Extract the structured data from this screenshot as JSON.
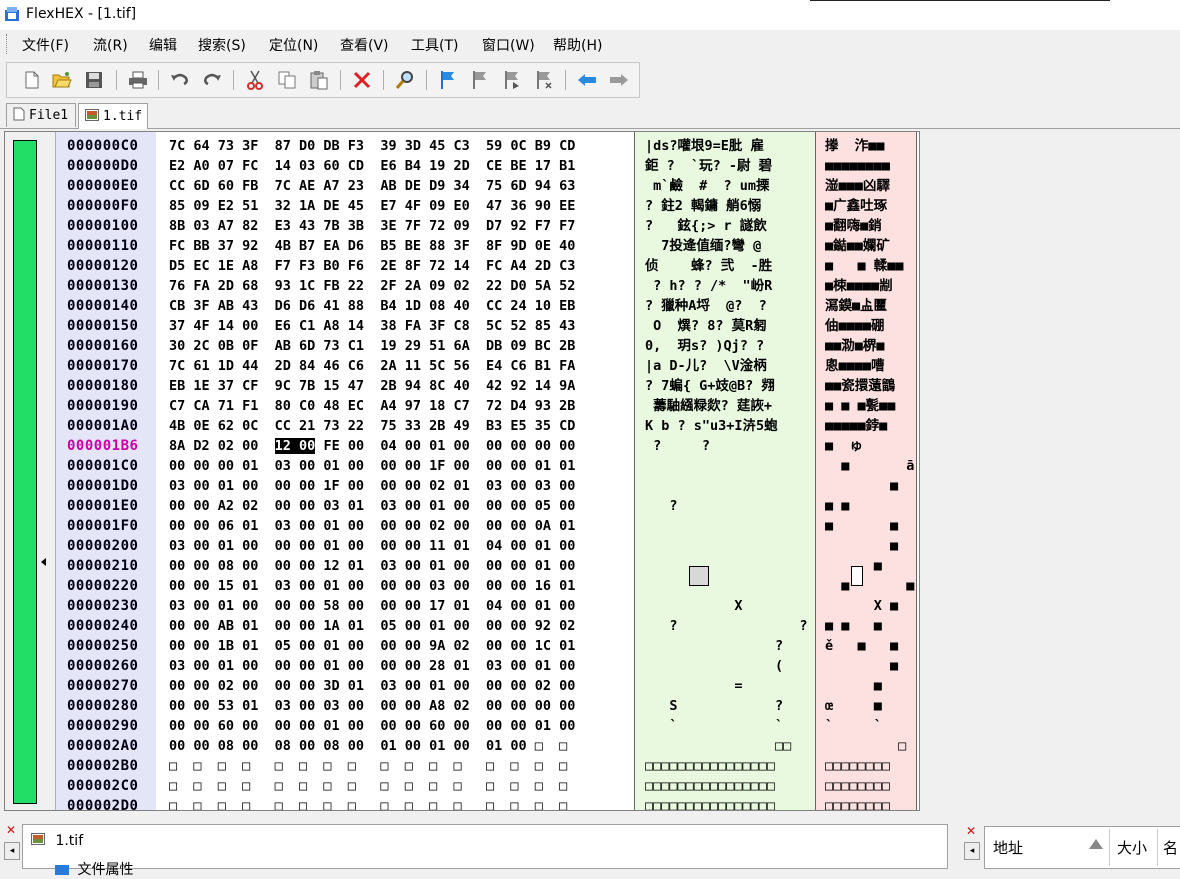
{
  "window": {
    "title": "FlexHEX - [1.tif]"
  },
  "menu": [
    "文件(F)",
    "流(R)",
    "编辑",
    "搜索(S)",
    "定位(N)",
    "查看(V)",
    "工具(T)",
    "窗口(W)",
    "帮助(H)"
  ],
  "toolbar": {
    "buttons": [
      {
        "name": "new-file-icon",
        "glyph": "🗋"
      },
      {
        "name": "open-folder-icon",
        "glyph": "📂"
      },
      {
        "name": "save-icon",
        "glyph": "💾"
      },
      {
        "name": "print-icon",
        "glyph": "🖶"
      },
      {
        "name": "undo-icon",
        "glyph": "↶"
      },
      {
        "name": "redo-icon",
        "glyph": "↷"
      },
      {
        "name": "cut-icon",
        "glyph": "✂"
      },
      {
        "name": "copy-icon",
        "glyph": "⎘"
      },
      {
        "name": "paste-icon",
        "glyph": "📋"
      },
      {
        "name": "delete-icon",
        "glyph": "✕"
      },
      {
        "name": "find-icon",
        "glyph": "🔎"
      },
      {
        "name": "bookmark-flag-icon",
        "glyph": "⚑"
      },
      {
        "name": "bookmark-prev-icon",
        "glyph": "⚑"
      },
      {
        "name": "bookmark-next-icon",
        "glyph": "⚑"
      },
      {
        "name": "bookmark-clear-icon",
        "glyph": "⚑"
      },
      {
        "name": "back-arrow-icon",
        "glyph": "⇦"
      },
      {
        "name": "forward-arrow-icon",
        "glyph": "⇨"
      }
    ]
  },
  "tabs": [
    {
      "label": "File1",
      "icon": "document-icon",
      "active": false
    },
    {
      "label": "1.tif",
      "icon": "image-file-icon",
      "active": true
    }
  ],
  "editor": {
    "rows": [
      {
        "addr": "000000C0",
        "hex": "7C 64 73 3F  87 D0 DB F3  39 3D 45 C3  59 0C B9 CD",
        "ascii": "|ds?嚾垠9=E肶 雇",
        "uni": "搼  泎■■"
      },
      {
        "addr": "000000D0",
        "hex": "E2 A0 07 FC  14 03 60 CD  E6 B4 19 2D  CE BE 17 B1",
        "ascii": "鉅 ?  `玩? -尉 碧",
        "uni": "■■■■■■■■"
      },
      {
        "addr": "000000E0",
        "hex": "CC 6D 60 FB  7C AE A7 23  AB DE D9 34  75 6D 94 63",
        "ascii": " m`鹼  #  ? um搮",
        "uni": "潂■■■凶驛"
      },
      {
        "addr": "000000F0",
        "hex": "85 09 E2 51  32 1A DE 45  E7 4F 09 E0  47 36 90 EE",
        "ascii": "? 鉒2 輵鏞 艄6愵",
        "uni": "■广鑫吐琢"
      },
      {
        "addr": "00000100",
        "hex": "8B 03 A7 82  E3 43 7B 3B  3E 7F 72 09  D7 92 F7 F7",
        "ascii": "?   鉉{;> r 譢飲",
        "uni": "■翻嗨■銷"
      },
      {
        "addr": "00000110",
        "hex": "FC BB 37 92  4B B7 EA D6  B5 BE 88 3F  8F 9D 0E 40",
        "ascii": "  7投逄值缅?彎 @",
        "uni": "■鐑■■孄矿"
      },
      {
        "addr": "00000120",
        "hex": "D5 EC 1E A8  F7 F3 B0 F6  2E 8F 72 14  FC A4 2D C3",
        "ascii": "侦    蜂? 弐  -胜",
        "uni": "■   ■ 輮■■"
      },
      {
        "addr": "00000130",
        "hex": "76 FA 2D 68  93 1C FB 22  2F 2A 09 02  22 D0 5A 52",
        "ascii": " ? h? ? /*  \"岎R",
        "uni": "■梀■■■■剬"
      },
      {
        "addr": "00000140",
        "hex": "CB 3F AB 43  D6 D6 41 88  B4 1D 08 40  CC 24 10 EB",
        "ascii": "? 獵种A埒  @?  ?",
        "uni": "㵼鏌■盀匷"
      },
      {
        "addr": "00000150",
        "hex": "37 4F 14 00  E6 C1 A8 14  38 FA 3F C8  5C 52 85 43",
        "ascii": " O  熼? 8? 莫R匑",
        "uni": "伷■■■■硼"
      },
      {
        "addr": "00000160",
        "hex": "30 2C 0B 0F  AB 6D 73 C1  19 29 51 6A  DB 09 BC 2B",
        "ascii": "0,  玥s? )Qj? ?",
        "uni": "■■泐■楐■"
      },
      {
        "addr": "00000170",
        "hex": "7C 61 1D 44  2D 84 46 C6  2A 11 5C 56  E4 C6 B1 FA",
        "ascii": "|a D-儿?  \\V淦柄",
        "uni": "悤■■■■嘈"
      },
      {
        "addr": "00000180",
        "hex": "EB 1E 37 CF  9C 7B 15 47  2B 94 8C 40  42 92 14 9A",
        "ascii": "? 7蝙{ G+攱@B? 翙",
        "uni": "■■瓷擐薳鶹"
      },
      {
        "addr": "00000190",
        "hex": "C7 CA 71 F1  80 C0 48 EC  A4 97 18 C7  72 D4 93 2B",
        "ascii": " 薵駎繦粶欻? 莛詼+",
        "uni": "■ ■ ■甏■■"
      },
      {
        "addr": "000001A0",
        "hex": "4B 0E 62 0C  CC 21 73 22  75 33 2B 49  B3 E5 35 CD",
        "ascii": "K b ? s\"u3+I泋5蚫",
        "uni": "■■■■■鋍■"
      },
      {
        "addr": "000001B6",
        "hex": "8A D2 02 00  12 00 FE 00  04 00 01 00  00 00 00 00",
        "ascii": " ?     ?",
        "uni": "■  ゅ",
        "current": true
      },
      {
        "addr": "000001C0",
        "hex": "00 00 00 01  03 00 01 00  00 00 1F 00  00 00 01 01",
        "ascii": "",
        "uni": "  ■       ā"
      },
      {
        "addr": "000001D0",
        "hex": "03 00 01 00  00 00 1F 00  00 00 02 01  03 00 03 00",
        "ascii": "",
        "uni": "        ■"
      },
      {
        "addr": "000001E0",
        "hex": "00 00 A2 02  00 00 03 01  03 00 01 00  00 00 05 00",
        "ascii": "   ?",
        "uni": "■ ■"
      },
      {
        "addr": "000001F0",
        "hex": "00 00 06 01  03 00 01 00  00 00 02 00  00 00 0A 01",
        "ascii": "",
        "uni": "■       ■"
      },
      {
        "addr": "00000200",
        "hex": "03 00 01 00  00 00 01 00  00 00 11 01  04 00 01 00",
        "ascii": "",
        "uni": "        ■"
      },
      {
        "addr": "00000210",
        "hex": "00 00 08 00  00 00 12 01  03 00 01 00  00 00 01 00",
        "ascii": "",
        "uni": "      ■"
      },
      {
        "addr": "00000220",
        "hex": "00 00 15 01  03 00 01 00  00 00 03 00  00 00 16 01",
        "ascii": "",
        "uni": "  ■       ■"
      },
      {
        "addr": "00000230",
        "hex": "03 00 01 00  00 00 58 00  00 00 17 01  04 00 01 00",
        "ascii": "           X",
        "uni": "      X ■"
      },
      {
        "addr": "00000240",
        "hex": "00 00 AB 01  00 00 1A 01  05 00 01 00  00 00 92 02",
        "ascii": "   ?               ?",
        "uni": "■ ■   ■"
      },
      {
        "addr": "00000250",
        "hex": "00 00 1B 01  05 00 01 00  00 00 9A 02  00 00 1C 01",
        "ascii": "                ?",
        "uni": "ě   ■   ■"
      },
      {
        "addr": "00000260",
        "hex": "03 00 01 00  00 00 01 00  00 00 28 01  03 00 01 00",
        "ascii": "                (",
        "uni": "        ■"
      },
      {
        "addr": "00000270",
        "hex": "00 00 02 00  00 00 3D 01  03 00 01 00  00 00 02 00",
        "ascii": "           =",
        "uni": "      ■"
      },
      {
        "addr": "00000280",
        "hex": "00 00 53 01  03 00 03 00  00 00 A8 02  00 00 00 00",
        "ascii": "   S            ?",
        "uni": "œ     ■"
      },
      {
        "addr": "00000290",
        "hex": "00 00 60 00  00 00 01 00  00 00 60 00  00 00 01 00",
        "ascii": "   `            `",
        "uni": "`     `"
      },
      {
        "addr": "000002A0",
        "hex": "00 00 08 00  08 00 08 00  01 00 01 00  01 00 □  □ ",
        "ascii": "                □□",
        "uni": "         □"
      },
      {
        "addr": "000002B0",
        "hex": "□  □  □  □   □  □  □  □   □  □  □  □   □  □  □  □ ",
        "ascii": "□□□□□□□□□□□□□□□□",
        "uni": "□□□□□□□□"
      },
      {
        "addr": "000002C0",
        "hex": "□  □  □  □   □  □  □  □   □  □  □  □   □  □  □  □ ",
        "ascii": "□□□□□□□□□□□□□□□□",
        "uni": "□□□□□□□□"
      },
      {
        "addr": "000002D0",
        "hex": "□  □  □  □   □  □  □  □   □  □  □  □   □  □  □  □ ",
        "ascii": "□□□□□□□□□□□□□□□□",
        "uni": "□□□□□□□□"
      }
    ]
  },
  "bottom_panel": {
    "file_label": "1.tif",
    "tree_item": "文件属性"
  },
  "right_panel": {
    "col_address": "地址",
    "col_size": "大小",
    "col_name": "名"
  }
}
